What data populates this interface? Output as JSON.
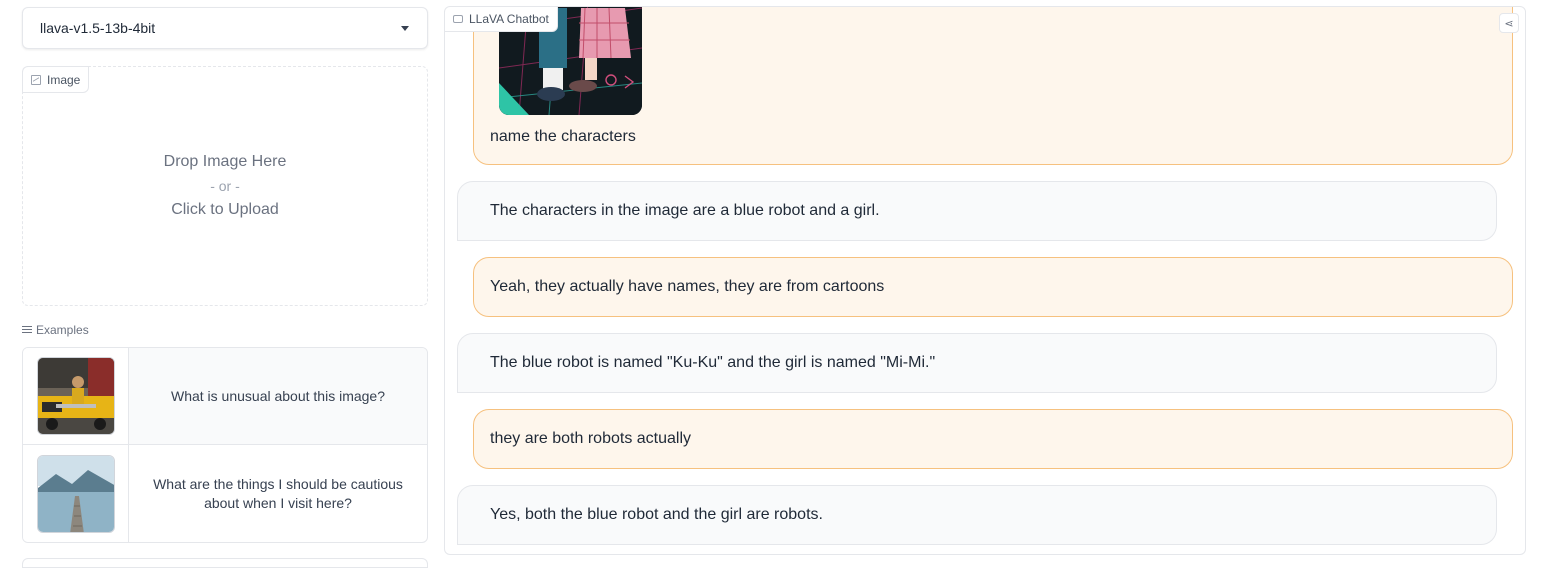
{
  "model_select": {
    "value": "llava-v1.5-13b-4bit"
  },
  "image_input": {
    "label": "Image",
    "drop_text": "Drop Image Here",
    "or_text": "- or -",
    "upload_text": "Click to Upload"
  },
  "examples": {
    "label": "Examples",
    "rows": [
      {
        "thumb_icon": "taxi-ironing-photo",
        "text": "What is unusual about this image?"
      },
      {
        "thumb_icon": "lake-dock-photo",
        "text": "What are the things I should be cautious about when I visit here?"
      }
    ]
  },
  "chatbot": {
    "label": "LLaVA Chatbot",
    "share_icon": "share-icon",
    "messages": [
      {
        "role": "user",
        "image": "anime-characters-image",
        "text": "name the characters"
      },
      {
        "role": "bot",
        "text": "The characters in the image are a blue robot and a girl."
      },
      {
        "role": "user",
        "text": "Yeah, they actually have names, they are from cartoons"
      },
      {
        "role": "bot",
        "text": "The blue robot is named \"Ku-Ku\" and the girl is named \"Mi-Mi.\""
      },
      {
        "role": "user",
        "text": "they are both robots actually"
      },
      {
        "role": "bot",
        "text": "Yes, both the blue robot and the girl are robots."
      }
    ]
  },
  "colors": {
    "user_bubble_bg": "#fef6ec",
    "user_bubble_border": "#f6c17f",
    "bot_bubble_bg": "#f9fafb",
    "border": "#e5e7eb"
  }
}
